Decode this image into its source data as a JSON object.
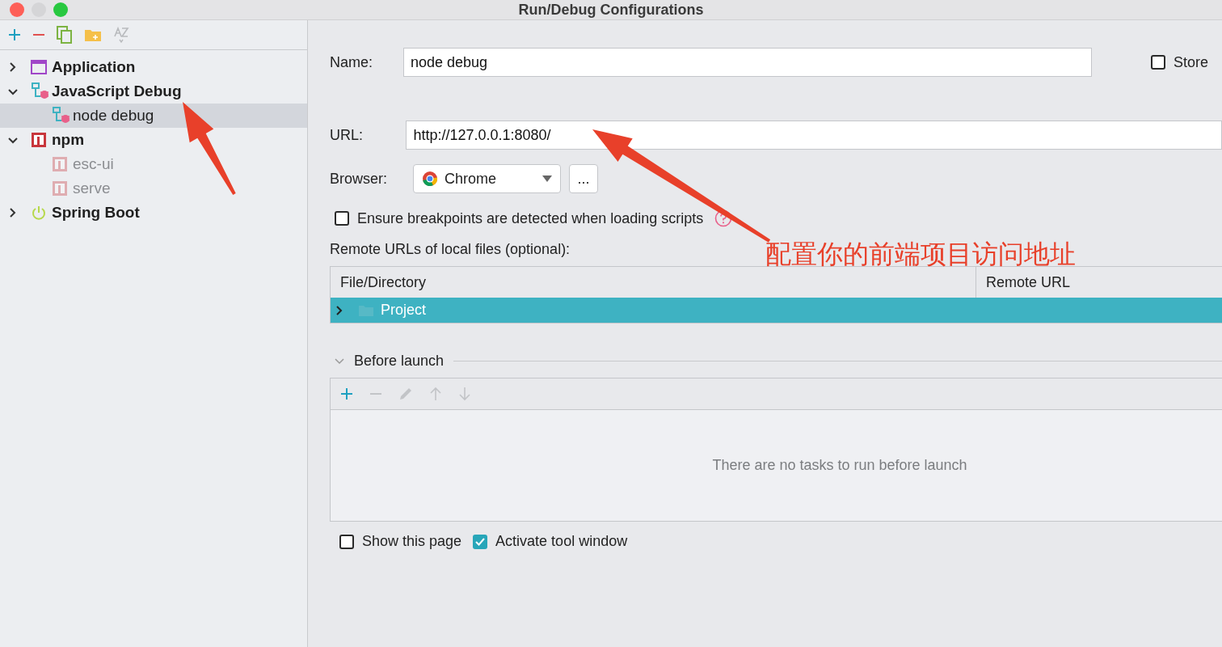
{
  "window": {
    "title": "Run/Debug Configurations"
  },
  "tree": [
    {
      "label": "Application",
      "kind": "application",
      "expanded": false
    },
    {
      "label": "JavaScript Debug",
      "kind": "jsdebug",
      "expanded": true,
      "children": [
        {
          "label": "node debug",
          "kind": "jsdebug",
          "selected": true,
          "dimmed": false
        }
      ]
    },
    {
      "label": "npm",
      "kind": "npm",
      "expanded": true,
      "children": [
        {
          "label": "esc-ui",
          "kind": "npm",
          "selected": false,
          "dimmed": true
        },
        {
          "label": "serve",
          "kind": "npm",
          "selected": false,
          "dimmed": true
        }
      ]
    },
    {
      "label": "Spring Boot",
      "kind": "spring",
      "expanded": false
    }
  ],
  "form": {
    "name_label": "Name:",
    "name_value": "node debug",
    "store_label": "Store",
    "store_checked": false,
    "url_label": "URL:",
    "url_value": "http://127.0.0.1:8080/",
    "browser_label": "Browser:",
    "browser_value": "Chrome",
    "more_button": "...",
    "ensure_label": "Ensure breakpoints are detected when loading scripts",
    "ensure_checked": false,
    "remote_label": "Remote URLs of local files (optional):"
  },
  "remote_table": {
    "columns": [
      "File/Directory",
      "Remote URL"
    ],
    "rows": [
      {
        "label": "Project",
        "selected": true,
        "expanded": false
      }
    ]
  },
  "before_launch": {
    "title": "Before launch",
    "expanded": true,
    "empty_text": "There are no tasks to run before launch"
  },
  "options": [
    {
      "label": "Show this page",
      "checked": false
    },
    {
      "label": "Activate tool window",
      "checked": true
    }
  ],
  "annotation": {
    "text": "配置你的前端项目访问地址"
  }
}
